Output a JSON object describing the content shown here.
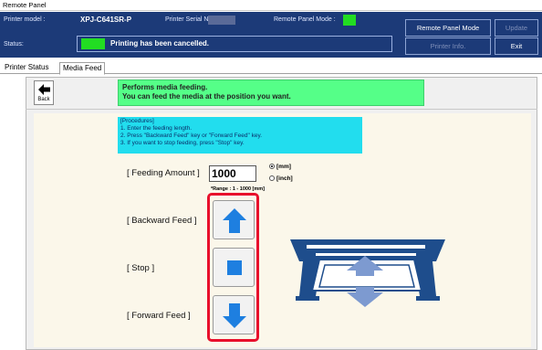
{
  "window": {
    "title": "Remote Panel"
  },
  "header": {
    "printer_model_label": "Printer model :",
    "printer_model_value": "XPJ-C641SR-P",
    "serial_label": "Printer Serial No. :",
    "remote_mode_label": "Remote Panel Mode :",
    "status_label": "Status:",
    "status_text": "Printing has been cancelled.",
    "status_color": "#22dd22",
    "mode_color": "#22dd22",
    "buttons": {
      "remote_panel_mode": "Remote Panel Mode",
      "update": "Update",
      "printer_info": "Printer Info.",
      "exit": "Exit"
    }
  },
  "tabs": [
    {
      "label": "Printer Status",
      "active": false
    },
    {
      "label": "Media Feed",
      "active": true
    }
  ],
  "panel": {
    "back_label": "Back",
    "info_line1": "Performs media feeding.",
    "info_line2": "You can feed the media at the position you want.",
    "procedures": [
      "[Procedures]",
      "1. Enter the feeding length.",
      "2. Press \"Backward Feed\" key or \"Forward Feed\" key.",
      "3. If you want to stop feeding, press \"Stop\" key."
    ],
    "feeding_amount_label": "[ Feeding Amount ]",
    "feeding_amount_value": "1000",
    "unit_mm": "[mm]",
    "unit_inch": "[inch]",
    "unit_selected": "mm",
    "range_text": "*Range : 1 - 1000 [mm]",
    "backward_label": "[ Backward Feed ]",
    "stop_label": "[ Stop ]",
    "forward_label": "[ Forward Feed ]"
  },
  "colors": {
    "header_bg": "#1c3a78",
    "info_bg": "#55ff88",
    "procedure_bg": "#22ddee",
    "highlight": "#e8102c",
    "button_blue": "#1e7fe0"
  },
  "icons": {
    "back": "arrow-left-icon",
    "backward_feed": "arrow-up-icon",
    "stop": "stop-square-icon",
    "forward_feed": "arrow-down-icon",
    "printer": "printer-illustration-icon"
  }
}
